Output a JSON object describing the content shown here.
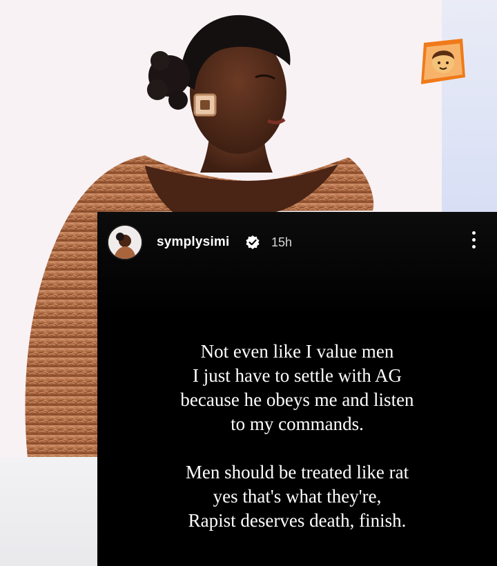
{
  "story": {
    "username": "symplysimi",
    "time": "15h",
    "lines_1": [
      "Not even like I value men",
      "I just have to settle with AG",
      "because he obeys me and listen",
      "to my commands."
    ],
    "lines_2": [
      "Men should be treated like rat",
      "yes that's what they're,",
      "Rapist deserves death, finish."
    ]
  },
  "icons": {
    "verified": "verified-badge-icon",
    "more": "more-options-icon",
    "sticker": "person-emoji-sticker-icon"
  },
  "colors": {
    "story_bg": "#000000",
    "verified_badge": "#ffffff",
    "sticker_orange": "#f07a1a"
  }
}
